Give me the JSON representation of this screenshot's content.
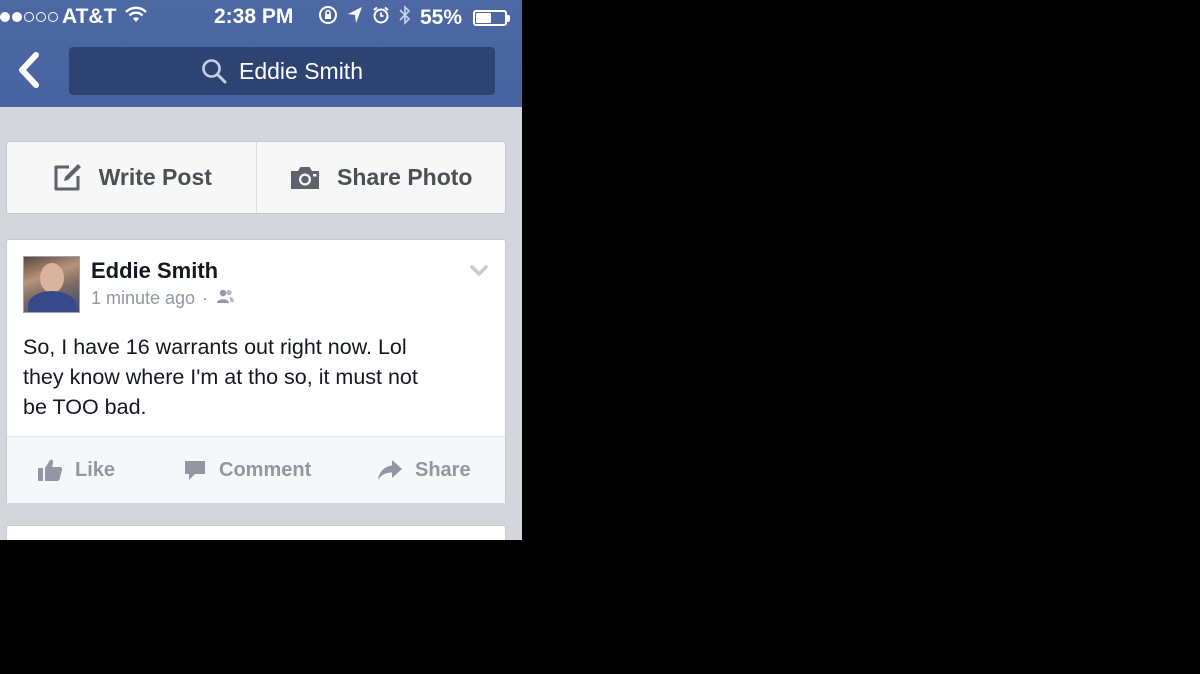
{
  "status_bar": {
    "signal_dots_filled": 2,
    "signal_dots_total": 5,
    "carrier": "AT&T",
    "time": "2:38 PM",
    "battery_percent": "55%",
    "battery_level": 0.55,
    "icons": [
      "wifi-icon",
      "orientation-lock-icon",
      "location-arrow-icon",
      "alarm-icon",
      "bluetooth-icon",
      "battery-icon"
    ]
  },
  "nav": {
    "back_icon": "chevron-left-icon",
    "search_value": "Eddie Smith",
    "search_icon": "search-icon"
  },
  "composer": {
    "write_post_label": "Write Post",
    "share_photo_label": "Share Photo",
    "icons": [
      "pencil-square-icon",
      "camera-icon"
    ]
  },
  "post": {
    "author": "Eddie Smith",
    "time": "1 minute ago",
    "separator": "·",
    "privacy_icon": "friends-icon",
    "text_lines": [
      "So, I have 16 warrants out right now. Lol",
      "they know where I'm at tho so, it must not",
      "be TOO bad."
    ],
    "actions": {
      "like": "Like",
      "comment": "Comment",
      "share": "Share"
    }
  },
  "colors": {
    "header_blue": "#4b67a1",
    "search_bg": "#2d4473",
    "feed_bg": "#d3d6db",
    "action_text": "#9197a3",
    "page_bg": "#000000"
  }
}
